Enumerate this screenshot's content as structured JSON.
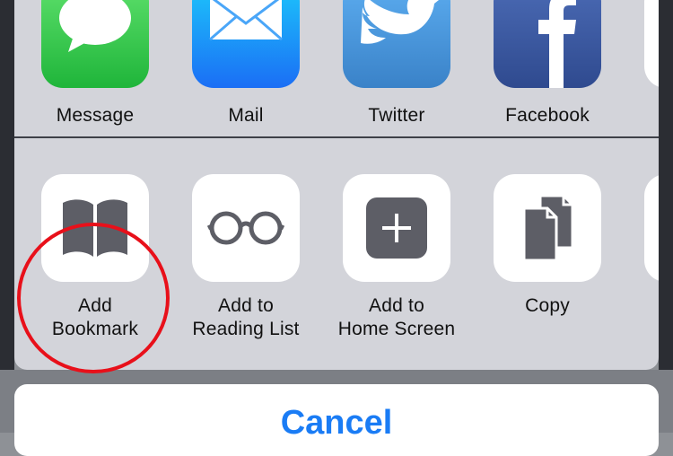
{
  "share_row": [
    {
      "label": "Message",
      "icon": "message-icon",
      "color": "#34c84a"
    },
    {
      "label": "Mail",
      "icon": "mail-icon",
      "color": "#1e8ef8"
    },
    {
      "label": "Twitter",
      "icon": "twitter-icon",
      "color": "#4a95d8"
    },
    {
      "label": "Facebook",
      "icon": "facebook-icon",
      "color": "#3b5998"
    }
  ],
  "action_row": [
    {
      "label": "Add\nBookmark",
      "icon": "bookmark-icon"
    },
    {
      "label": "Add to\nReading List",
      "icon": "glasses-icon"
    },
    {
      "label": "Add to\nHome Screen",
      "icon": "add-square-icon"
    },
    {
      "label": "Copy",
      "icon": "copy-icon"
    }
  ],
  "cancel_label": "Cancel",
  "colors": {
    "accent": "#1a7cf5",
    "highlight": "#e8101a",
    "icon_gray": "#5d5e66"
  }
}
